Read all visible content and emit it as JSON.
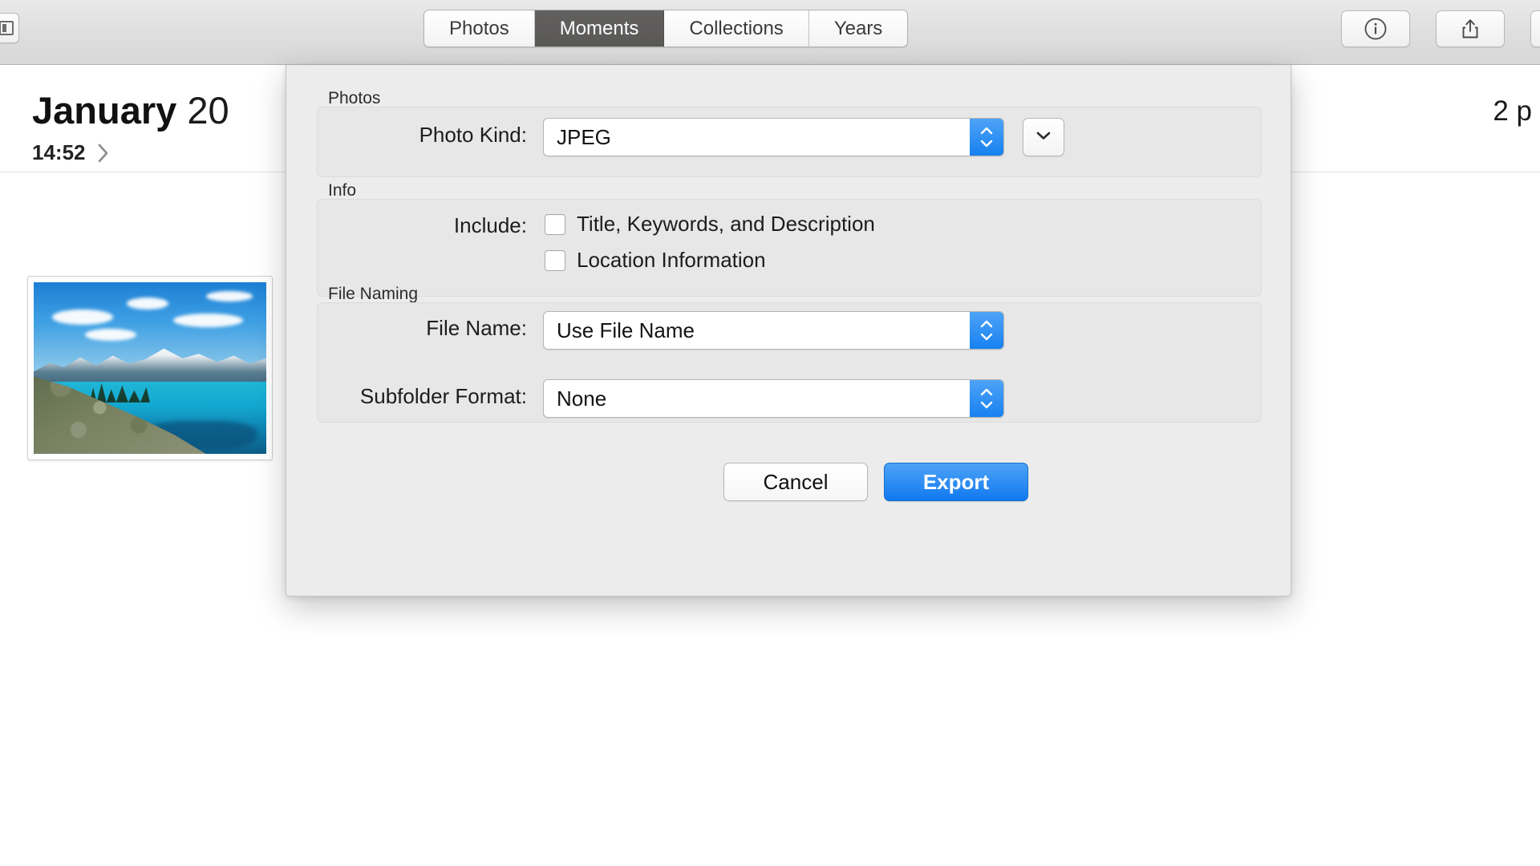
{
  "toolbar": {
    "left_button_icon": "sidebar-icon",
    "segments": [
      {
        "label": "Photos",
        "selected": false
      },
      {
        "label": "Moments",
        "selected": true
      },
      {
        "label": "Collections",
        "selected": false
      },
      {
        "label": "Years",
        "selected": false
      }
    ],
    "buttons": [
      {
        "icon": "info-icon",
        "name": "info-button"
      },
      {
        "icon": "share-icon",
        "name": "share-button"
      },
      {
        "icon": "blank-icon",
        "name": "extra-toolbar-button"
      }
    ]
  },
  "content": {
    "moment_title_bold": "January",
    "moment_title_rest": " 20",
    "moment_count": "2 p",
    "moment_time": "14:52",
    "chevron_icon": "chevron-right-icon",
    "thumbnail_alt": "mountain-lake-photo"
  },
  "dialog": {
    "sections": {
      "photos": {
        "label": "Photos",
        "photo_kind_label": "Photo Kind:",
        "photo_kind_value": "JPEG",
        "extra_button_icon": "chevron-down-icon"
      },
      "info": {
        "label": "Info",
        "include_label": "Include:",
        "checkboxes": [
          {
            "label": "Title, Keywords, and Description",
            "checked": false
          },
          {
            "label": "Location Information",
            "checked": false
          }
        ]
      },
      "file_naming": {
        "label": "File Naming",
        "file_name_label": "File Name:",
        "file_name_value": "Use File Name",
        "subfolder_label": "Subfolder Format:",
        "subfolder_value": "None"
      }
    },
    "cancel_label": "Cancel",
    "export_label": "Export"
  },
  "colors": {
    "accent_blue": "#1079ef",
    "selected_segment": "#5a5958",
    "dialog_bg": "#ececec",
    "group_bg": "#e7e7e7"
  }
}
